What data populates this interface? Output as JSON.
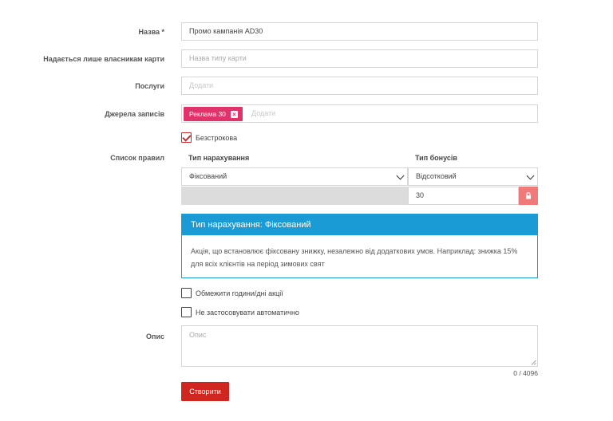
{
  "form": {
    "name": {
      "label": "Назва *",
      "value": "Промо кампанія AD30"
    },
    "card_owners": {
      "label": "Надається лише власникам карти",
      "placeholder": "Назва типу карти"
    },
    "services": {
      "label": "Послуги",
      "placeholder": "Додати"
    },
    "sources": {
      "label": "Джерела записів",
      "chip": "Реклама 30",
      "chip_remove_icon": "close-icon",
      "placeholder": "Додати"
    },
    "unlimited": {
      "label": "Безстрокова",
      "checked": true
    },
    "rules": {
      "label": "Список правил",
      "accrual_type_header": "Тип нарахування",
      "bonus_type_header": "Тип бонусів",
      "accrual_type_value": "Фіксований",
      "bonus_type_value": "Відсотковий",
      "bonus_value": "30",
      "lock_icon": "lock-icon"
    },
    "info": {
      "title": "Тип нарахування: Фіксований",
      "text": "Акція, що встановлює фіксовану знижку, незалежно від додаткових умов. Наприклад: знижка 15% для всіх клієнтів на період зимових свят"
    },
    "limit_hours": {
      "label": "Обмежити години/дні акції",
      "checked": false
    },
    "no_auto_apply": {
      "label": "Не застосовувати автоматично",
      "checked": false
    },
    "description": {
      "label": "Опис",
      "placeholder": "Опис",
      "counter": "0 / 4096"
    },
    "submit_label": "Створити"
  },
  "colors": {
    "accent_red": "#d1261f",
    "chip_pink": "#e0336b",
    "info_blue": "#1a9bd6",
    "lock_bg": "#f07a7a"
  }
}
